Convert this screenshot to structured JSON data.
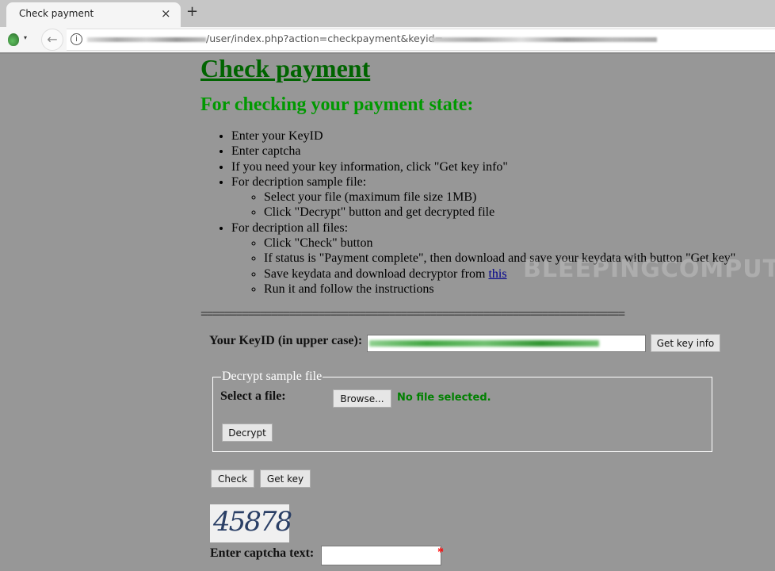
{
  "browser": {
    "tab_title": "Check payment",
    "tab_close_icon": "×",
    "new_tab_icon": "+",
    "back_icon": "←",
    "info_icon": "i",
    "dropdown_caret": "▾",
    "url_visible": "/user/index.php?action=checkpayment&keyid="
  },
  "page": {
    "title": "Check payment",
    "subtitle": "For checking your payment state:",
    "instructions": [
      "Enter your KeyID",
      "Enter captcha",
      "If you need your key information, click \"Get key info\"",
      "For decription sample file:",
      "For decription all files:"
    ],
    "sample_steps": [
      "Select your file (maximum file size 1MB)",
      "Click \"Decrypt\" button and get decrypted file"
    ],
    "all_steps": [
      "Click \"Check\" button",
      "If status is \"Payment complete\", then download and save your keydata with button \"Get key\"",
      "Save keydata and download decryptor from ",
      "Run it and follow the instructions"
    ],
    "link_text": "this",
    "separator": "========================================================================"
  },
  "form": {
    "keyid_label": "Your KeyID (in upper case):",
    "get_key_info": "Get key info",
    "fieldset_legend": "Decrypt sample file",
    "select_file_label": "Select a file:",
    "browse": "Browse...",
    "no_file": "No file selected.",
    "decrypt": "Decrypt",
    "check": "Check",
    "get_key": "Get key",
    "captcha_image_text": "45878",
    "captcha_label": "Enter captcha text:",
    "captcha_value": "",
    "required_mark": "*"
  },
  "watermark": "BLEEPINGCOMPUTER",
  "colors": {
    "page_bg": "#979797",
    "title": "#006400",
    "subtitle": "#009900",
    "no_file": "#008000",
    "link": "#00008b"
  }
}
